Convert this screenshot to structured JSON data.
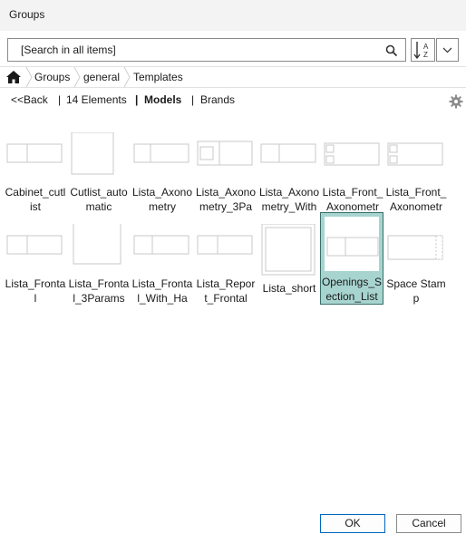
{
  "window": {
    "title": "Groups"
  },
  "search": {
    "placeholder": "[Search in all items]"
  },
  "breadcrumb": {
    "items": [
      "Groups",
      "general",
      "Templates"
    ]
  },
  "toolbar": {
    "back": "<<Back",
    "sep1": "|",
    "count": "14 Elements",
    "sep2": "|",
    "models": "Models",
    "sep3": "|",
    "brands": "Brands"
  },
  "items": [
    {
      "label": "Cabinet_cutlist"
    },
    {
      "label": "Cutlist_automatic"
    },
    {
      "label": "Lista_Axonometry"
    },
    {
      "label": "Lista_Axonometry_3Pa"
    },
    {
      "label": "Lista_Axonometry_With"
    },
    {
      "label": "Lista_Front_Axonometr"
    },
    {
      "label": "Lista_Front_Axonometr"
    },
    {
      "label": "Lista_Frontal"
    },
    {
      "label": "Lista_Frontal_3Params"
    },
    {
      "label": "Lista_Frontal_With_Ha"
    },
    {
      "label": "Lista_Report_Frontal"
    },
    {
      "label": "Lista_short"
    },
    {
      "label": "Openings_Section_List",
      "selected": true
    },
    {
      "label": "Space Stamp"
    }
  ],
  "buttons": {
    "ok": "OK",
    "cancel": "Cancel"
  },
  "colors": {
    "selection": "#a7d4cf",
    "selection_border": "#3a6e68",
    "ok_border": "#0067c0"
  },
  "icons": {
    "home": "home-icon",
    "search": "search-icon",
    "sort": "sort-az-icon",
    "dropdown": "chevron-down-icon",
    "settings": "gear-icon"
  }
}
